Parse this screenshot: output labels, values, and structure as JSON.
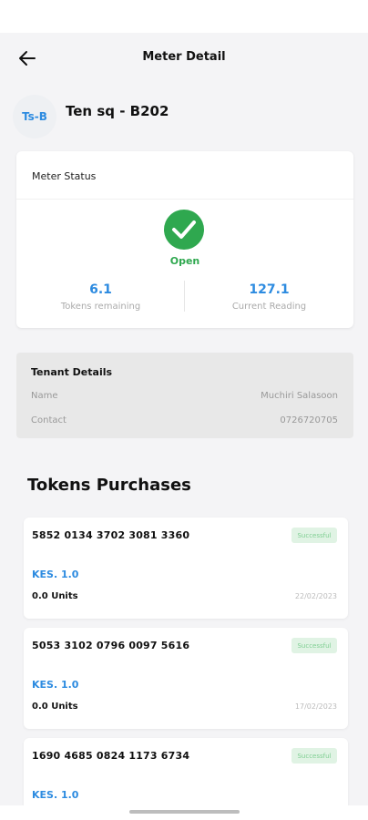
{
  "header": {
    "title": "Meter Detail"
  },
  "meter": {
    "avatar_initials": "Ts-B",
    "name": "Ten sq - B202"
  },
  "status_card": {
    "heading": "Meter Status",
    "status": "Open",
    "tokens_remaining": {
      "value": "6.1",
      "label": "Tokens remaining"
    },
    "current_reading": {
      "value": "127.1",
      "label": "Current Reading"
    }
  },
  "tenant": {
    "title": "Tenant Details",
    "name_label": "Name",
    "name_value": "Muchiri Salasoon",
    "contact_label": "Contact",
    "contact_value": "0726720705"
  },
  "purchases": {
    "title": "Tokens Purchases",
    "items": [
      {
        "token": "5852 0134 3702 3081 3360",
        "badge": "Successful",
        "amount": "KES. 1.0",
        "units": "0.0 Units",
        "date": "22/02/2023"
      },
      {
        "token": "5053 3102 0796 0097 5616",
        "badge": "Successful",
        "amount": "KES. 1.0",
        "units": "0.0 Units",
        "date": "17/02/2023"
      },
      {
        "token": "1690 4685 0824 1173 6734",
        "badge": "Successful",
        "amount": "KES. 1.0",
        "units": "",
        "date": ""
      }
    ]
  },
  "colors": {
    "accent": "#2d8be0",
    "success": "#2fa84f",
    "badge_bg": "#e0f3e4"
  },
  "icons": {
    "back": "arrow-left-icon",
    "status": "check-circle-icon"
  }
}
